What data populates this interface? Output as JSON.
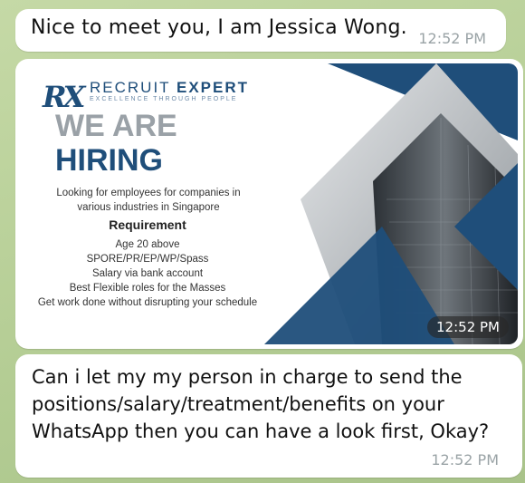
{
  "messages": [
    {
      "text": "Nice to meet you, I am Jessica Wong.",
      "time": "12:52 PM"
    },
    {
      "time": "12:52 PM"
    },
    {
      "text": "Can i let my my person in charge to send the positions/salary/treatment/benefits on your WhatsApp then you can have a look first, Okay?",
      "time": "12:52 PM"
    }
  ],
  "poster": {
    "logo_mark": "RX",
    "brand_light": "RECRUIT",
    "brand_bold": "EXPERT",
    "tagline": "EXCELLENCE THROUGH PEOPLE",
    "headline_1": "WE ARE",
    "headline_2": "HIRING",
    "intro": "Looking for employees for companies in various industries in Singapore",
    "requirement_title": "Requirement",
    "requirements": [
      "Age 20 above",
      "SPORE/PR/EP/WP/Spass",
      "Salary via bank account",
      "Best Flexible roles for the Masses",
      "Get work done without disrupting your schedule"
    ]
  },
  "colors": {
    "navy": "#1f4e7a",
    "grey_heading": "#9aa1a7",
    "chat_bg": "#b9cf9a"
  }
}
